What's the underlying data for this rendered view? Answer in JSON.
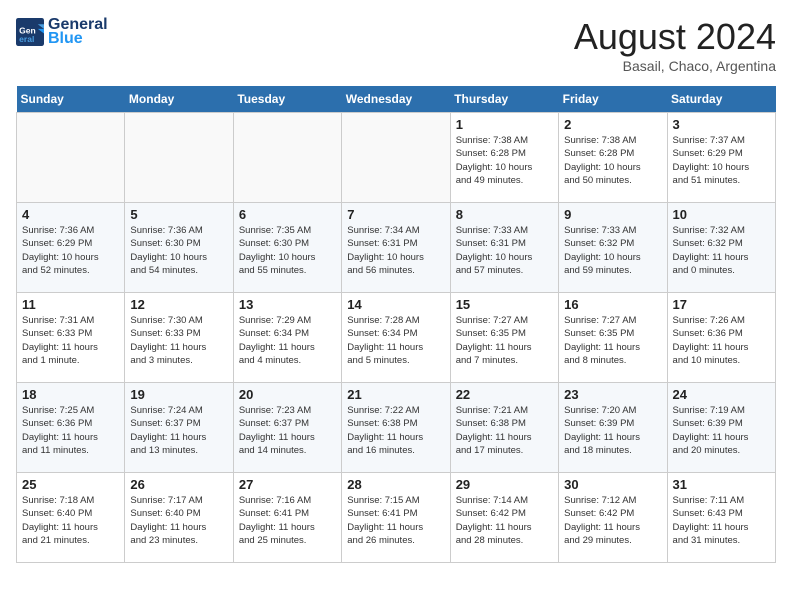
{
  "header": {
    "logo_line1": "General",
    "logo_line2": "Blue",
    "month_title": "August 2024",
    "location": "Basail, Chaco, Argentina"
  },
  "weekdays": [
    "Sunday",
    "Monday",
    "Tuesday",
    "Wednesday",
    "Thursday",
    "Friday",
    "Saturday"
  ],
  "weeks": [
    [
      {
        "day": "",
        "text": ""
      },
      {
        "day": "",
        "text": ""
      },
      {
        "day": "",
        "text": ""
      },
      {
        "day": "",
        "text": ""
      },
      {
        "day": "1",
        "text": "Sunrise: 7:38 AM\nSunset: 6:28 PM\nDaylight: 10 hours\nand 49 minutes."
      },
      {
        "day": "2",
        "text": "Sunrise: 7:38 AM\nSunset: 6:28 PM\nDaylight: 10 hours\nand 50 minutes."
      },
      {
        "day": "3",
        "text": "Sunrise: 7:37 AM\nSunset: 6:29 PM\nDaylight: 10 hours\nand 51 minutes."
      }
    ],
    [
      {
        "day": "4",
        "text": "Sunrise: 7:36 AM\nSunset: 6:29 PM\nDaylight: 10 hours\nand 52 minutes."
      },
      {
        "day": "5",
        "text": "Sunrise: 7:36 AM\nSunset: 6:30 PM\nDaylight: 10 hours\nand 54 minutes."
      },
      {
        "day": "6",
        "text": "Sunrise: 7:35 AM\nSunset: 6:30 PM\nDaylight: 10 hours\nand 55 minutes."
      },
      {
        "day": "7",
        "text": "Sunrise: 7:34 AM\nSunset: 6:31 PM\nDaylight: 10 hours\nand 56 minutes."
      },
      {
        "day": "8",
        "text": "Sunrise: 7:33 AM\nSunset: 6:31 PM\nDaylight: 10 hours\nand 57 minutes."
      },
      {
        "day": "9",
        "text": "Sunrise: 7:33 AM\nSunset: 6:32 PM\nDaylight: 10 hours\nand 59 minutes."
      },
      {
        "day": "10",
        "text": "Sunrise: 7:32 AM\nSunset: 6:32 PM\nDaylight: 11 hours\nand 0 minutes."
      }
    ],
    [
      {
        "day": "11",
        "text": "Sunrise: 7:31 AM\nSunset: 6:33 PM\nDaylight: 11 hours\nand 1 minute."
      },
      {
        "day": "12",
        "text": "Sunrise: 7:30 AM\nSunset: 6:33 PM\nDaylight: 11 hours\nand 3 minutes."
      },
      {
        "day": "13",
        "text": "Sunrise: 7:29 AM\nSunset: 6:34 PM\nDaylight: 11 hours\nand 4 minutes."
      },
      {
        "day": "14",
        "text": "Sunrise: 7:28 AM\nSunset: 6:34 PM\nDaylight: 11 hours\nand 5 minutes."
      },
      {
        "day": "15",
        "text": "Sunrise: 7:27 AM\nSunset: 6:35 PM\nDaylight: 11 hours\nand 7 minutes."
      },
      {
        "day": "16",
        "text": "Sunrise: 7:27 AM\nSunset: 6:35 PM\nDaylight: 11 hours\nand 8 minutes."
      },
      {
        "day": "17",
        "text": "Sunrise: 7:26 AM\nSunset: 6:36 PM\nDaylight: 11 hours\nand 10 minutes."
      }
    ],
    [
      {
        "day": "18",
        "text": "Sunrise: 7:25 AM\nSunset: 6:36 PM\nDaylight: 11 hours\nand 11 minutes."
      },
      {
        "day": "19",
        "text": "Sunrise: 7:24 AM\nSunset: 6:37 PM\nDaylight: 11 hours\nand 13 minutes."
      },
      {
        "day": "20",
        "text": "Sunrise: 7:23 AM\nSunset: 6:37 PM\nDaylight: 11 hours\nand 14 minutes."
      },
      {
        "day": "21",
        "text": "Sunrise: 7:22 AM\nSunset: 6:38 PM\nDaylight: 11 hours\nand 16 minutes."
      },
      {
        "day": "22",
        "text": "Sunrise: 7:21 AM\nSunset: 6:38 PM\nDaylight: 11 hours\nand 17 minutes."
      },
      {
        "day": "23",
        "text": "Sunrise: 7:20 AM\nSunset: 6:39 PM\nDaylight: 11 hours\nand 18 minutes."
      },
      {
        "day": "24",
        "text": "Sunrise: 7:19 AM\nSunset: 6:39 PM\nDaylight: 11 hours\nand 20 minutes."
      }
    ],
    [
      {
        "day": "25",
        "text": "Sunrise: 7:18 AM\nSunset: 6:40 PM\nDaylight: 11 hours\nand 21 minutes."
      },
      {
        "day": "26",
        "text": "Sunrise: 7:17 AM\nSunset: 6:40 PM\nDaylight: 11 hours\nand 23 minutes."
      },
      {
        "day": "27",
        "text": "Sunrise: 7:16 AM\nSunset: 6:41 PM\nDaylight: 11 hours\nand 25 minutes."
      },
      {
        "day": "28",
        "text": "Sunrise: 7:15 AM\nSunset: 6:41 PM\nDaylight: 11 hours\nand 26 minutes."
      },
      {
        "day": "29",
        "text": "Sunrise: 7:14 AM\nSunset: 6:42 PM\nDaylight: 11 hours\nand 28 minutes."
      },
      {
        "day": "30",
        "text": "Sunrise: 7:12 AM\nSunset: 6:42 PM\nDaylight: 11 hours\nand 29 minutes."
      },
      {
        "day": "31",
        "text": "Sunrise: 7:11 AM\nSunset: 6:43 PM\nDaylight: 11 hours\nand 31 minutes."
      }
    ]
  ]
}
